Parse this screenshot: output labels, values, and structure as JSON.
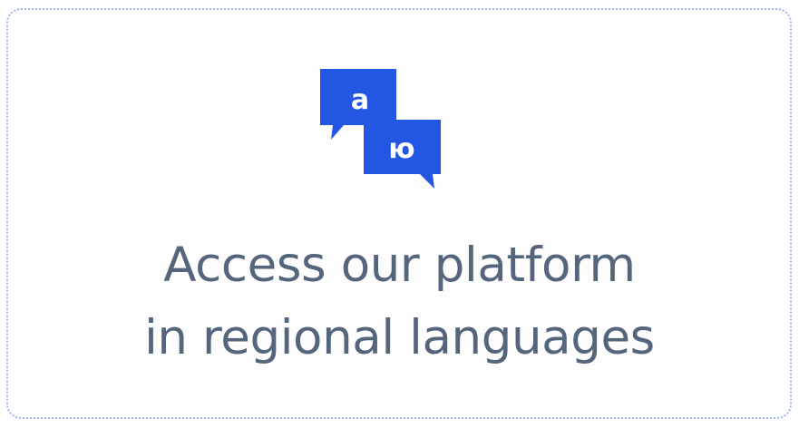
{
  "card": {
    "icon": {
      "name": "regional-language-chat-icon",
      "glyph_left": "a",
      "glyph_right": "ю",
      "color": "#2356e3"
    },
    "headline_line1": "Access our platform",
    "headline_line2": "in regional languages",
    "text_color": "#55657b",
    "border_color": "#9db7ee"
  }
}
